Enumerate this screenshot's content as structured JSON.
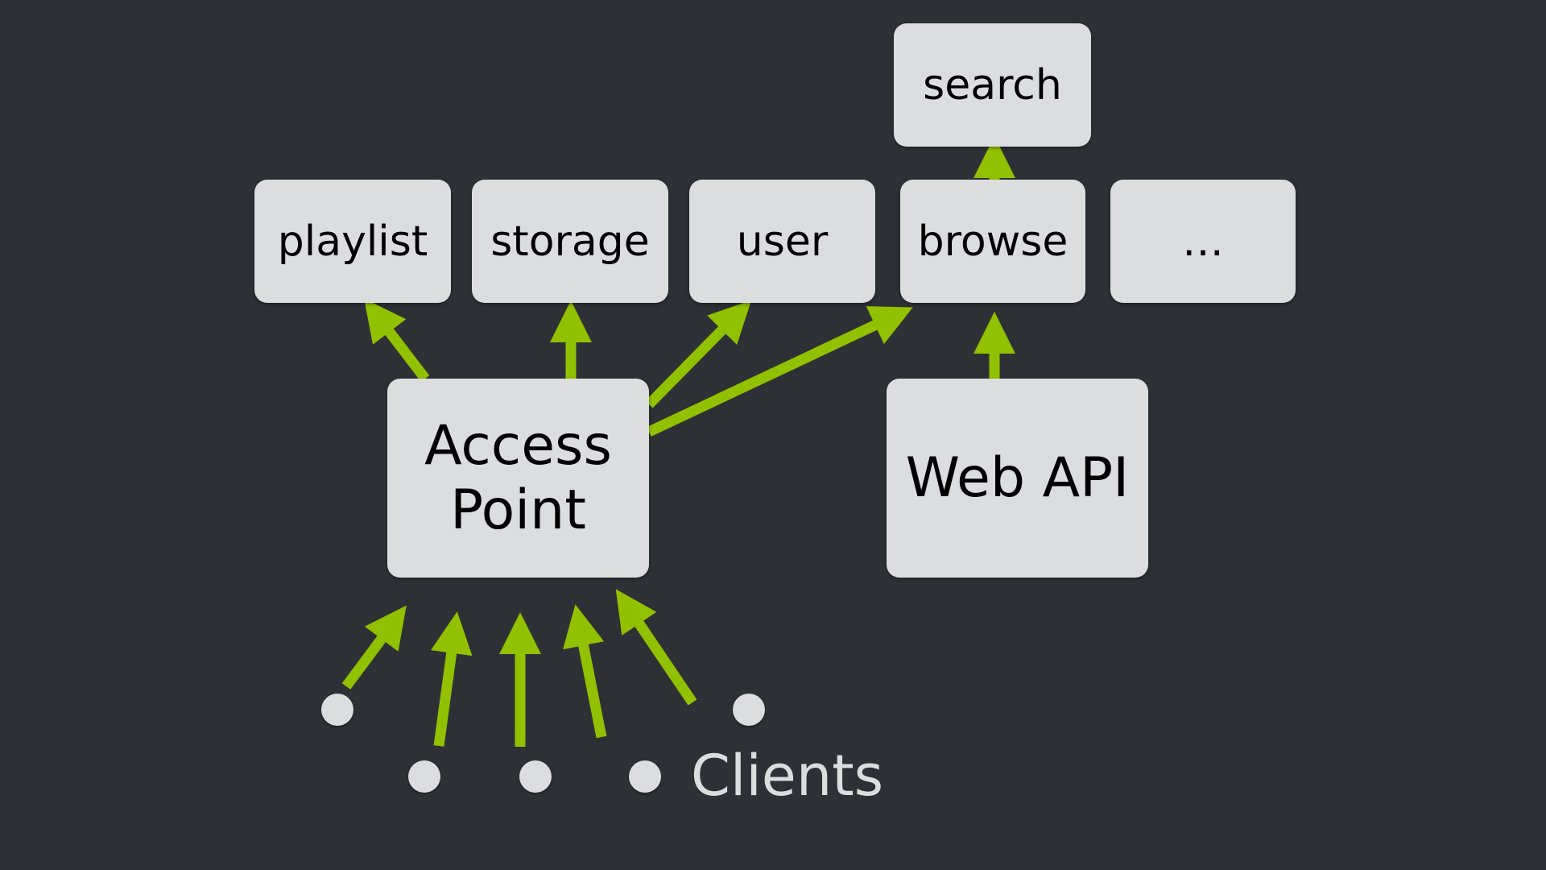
{
  "colors": {
    "background": "#2d3136",
    "arrow": "#91c100",
    "box": "#dcdddf"
  },
  "services": {
    "search": "search",
    "playlist": "playlist",
    "storage": "storage",
    "user": "user",
    "browse": "browse",
    "more": "…"
  },
  "gateways": {
    "access_point": "Access\nPoint",
    "web_api": "Web API"
  },
  "clients_label": "Clients",
  "edges": [
    {
      "from": "access_point",
      "to": "playlist"
    },
    {
      "from": "access_point",
      "to": "storage"
    },
    {
      "from": "access_point",
      "to": "user"
    },
    {
      "from": "access_point",
      "to": "browse"
    },
    {
      "from": "web_api",
      "to": "browse"
    },
    {
      "from": "browse",
      "to": "search"
    },
    {
      "from": "client",
      "to": "access_point",
      "count": 5
    }
  ]
}
